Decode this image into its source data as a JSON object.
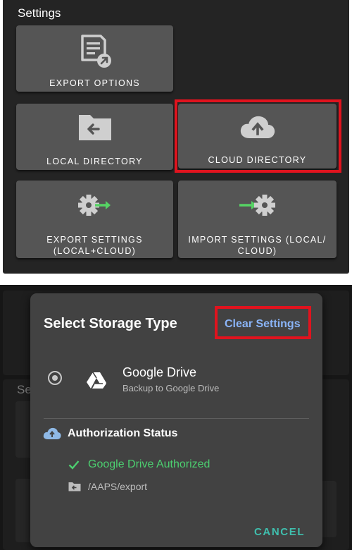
{
  "settings": {
    "title": "Settings",
    "tiles": {
      "export_options": "EXPORT OPTIONS",
      "local_directory": "LOCAL DIRECTORY",
      "cloud_directory": "CLOUD DIRECTORY",
      "export_settings_line1": "EXPORT SETTINGS",
      "export_settings_line2": "(LOCAL+CLOUD)",
      "import_settings_line1": "IMPORT SETTINGS (LOCAL/",
      "import_settings_line2": "CLOUD)"
    }
  },
  "background": {
    "partial_title": "Se"
  },
  "dialog": {
    "title": "Select Storage Type",
    "clear_settings": "Clear Settings",
    "storage_option": {
      "name": "Google Drive",
      "description": "Backup to Google Drive",
      "selected": true
    },
    "authorization": {
      "title": "Authorization Status",
      "status": "Google Drive Authorized",
      "path": "/AAPS/export"
    },
    "cancel": "CANCEL"
  },
  "colors": {
    "highlight": "#e0131e",
    "link": "#8ab4f8",
    "success": "#4ccf70",
    "accent": "#3fbfae"
  }
}
